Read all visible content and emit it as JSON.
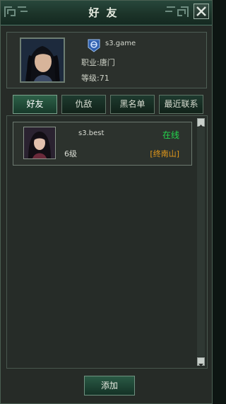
{
  "window": {
    "title": "好友"
  },
  "player": {
    "name": "s3.game",
    "class_label": "职业:唐门",
    "level_label": "等级:71"
  },
  "tabs": [
    {
      "label": "好友",
      "active": true
    },
    {
      "label": "仇敌",
      "active": false
    },
    {
      "label": "黑名单",
      "active": false
    },
    {
      "label": "最近联系",
      "active": false
    }
  ],
  "friends": [
    {
      "name": "s3.best",
      "status": "在线",
      "level": "6级",
      "location": "[终南山]"
    }
  ],
  "actions": {
    "add_label": "添加"
  },
  "colors": {
    "online": "#23d64d",
    "location": "#e69a1a",
    "panel": "#262c28"
  }
}
